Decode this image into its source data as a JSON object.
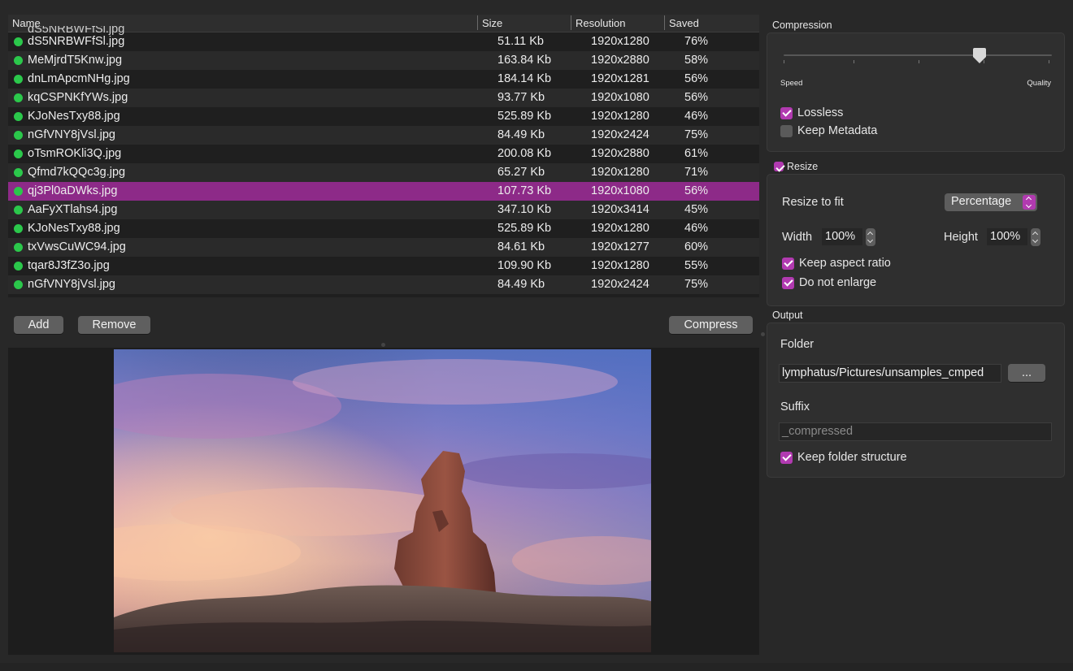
{
  "table": {
    "columns": {
      "name": "Name",
      "size": "Size",
      "resolution": "Resolution",
      "saved": "Saved"
    },
    "partial_row_name": "dS5NRBWFfSl.jpg",
    "rows": [
      {
        "name": "dS5NRBWFfSl.jpg",
        "size": "51.11 Kb",
        "resolution": "1920x1280",
        "saved": "76%"
      },
      {
        "name": "MeMjrdT5Knw.jpg",
        "size": "163.84 Kb",
        "resolution": "1920x2880",
        "saved": "58%"
      },
      {
        "name": "dnLmApcmNHg.jpg",
        "size": "184.14 Kb",
        "resolution": "1920x1281",
        "saved": "56%"
      },
      {
        "name": "kqCSPNKfYWs.jpg",
        "size": "93.77 Kb",
        "resolution": "1920x1080",
        "saved": "56%"
      },
      {
        "name": "KJoNesTxy88.jpg",
        "size": "525.89 Kb",
        "resolution": "1920x1280",
        "saved": "46%"
      },
      {
        "name": "nGfVNY8jVsl.jpg",
        "size": "84.49 Kb",
        "resolution": "1920x2424",
        "saved": "75%"
      },
      {
        "name": "oTsmROKli3Q.jpg",
        "size": "200.08 Kb",
        "resolution": "1920x2880",
        "saved": "61%"
      },
      {
        "name": "Qfmd7kQQc3g.jpg",
        "size": "65.27 Kb",
        "resolution": "1920x1280",
        "saved": "71%"
      },
      {
        "name": "qj3Pl0aDWks.jpg",
        "size": "107.73 Kb",
        "resolution": "1920x1080",
        "saved": "56%"
      },
      {
        "name": "AaFyXTlahs4.jpg",
        "size": "347.10 Kb",
        "resolution": "1920x3414",
        "saved": "45%"
      },
      {
        "name": "KJoNesTxy88.jpg",
        "size": "525.89 Kb",
        "resolution": "1920x1280",
        "saved": "46%"
      },
      {
        "name": "txVwsCuWC94.jpg",
        "size": "84.61 Kb",
        "resolution": "1920x1277",
        "saved": "60%"
      },
      {
        "name": "tqar8J3fZ3o.jpg",
        "size": "109.90 Kb",
        "resolution": "1920x1280",
        "saved": "55%"
      },
      {
        "name": "nGfVNY8jVsl.jpg",
        "size": "84.49 Kb",
        "resolution": "1920x2424",
        "saved": "75%"
      }
    ],
    "selected_index": 8,
    "status_dot_color": "#2bc84b",
    "selection_color": "#8d2a88"
  },
  "actions": {
    "add": "Add",
    "remove": "Remove",
    "compress": "Compress"
  },
  "compression": {
    "title": "Compression",
    "slider_min_label": "Speed",
    "slider_max_label": "Quality",
    "slider_level": 0.74,
    "lossless": {
      "label": "Lossless",
      "checked": true
    },
    "keep_metadata": {
      "label": "Keep Metadata",
      "checked": false
    }
  },
  "resize": {
    "title": "Resize",
    "enabled": true,
    "fit_label": "Resize to fit",
    "fit_mode": "Percentage",
    "width_label": "Width",
    "width_value": "100%",
    "height_label": "Height",
    "height_value": "100%",
    "keep_aspect": {
      "label": "Keep aspect ratio",
      "checked": true
    },
    "no_enlarge": {
      "label": "Do not enlarge",
      "checked": true
    }
  },
  "output": {
    "title": "Output",
    "folder_label": "Folder",
    "folder_path": "lymphatus/Pictures/unsamples_cmped",
    "browse_label": "...",
    "suffix_label": "Suffix",
    "suffix_placeholder": "_compressed",
    "keep_structure": {
      "label": "Keep folder structure",
      "checked": true
    }
  },
  "accent_color": "#b13ab0"
}
